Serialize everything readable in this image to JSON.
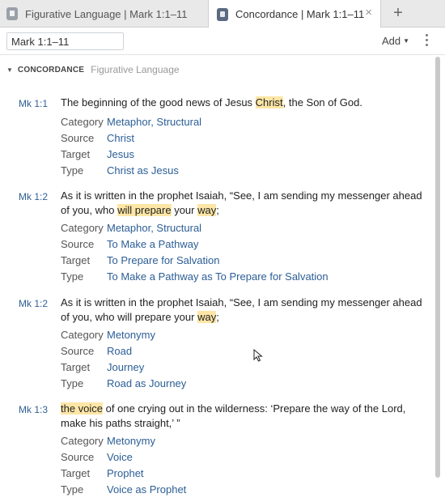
{
  "tabs": [
    {
      "label": "Figurative Language | Mark 1:1–11",
      "active": false
    },
    {
      "label": "Concordance | Mark 1:1–11",
      "active": true
    }
  ],
  "tab_close": "×",
  "tab_add": "+",
  "toolbar": {
    "reference_value": "Mark 1:1–11",
    "add_label": "Add"
  },
  "section": {
    "title": "CONCORDANCE",
    "subtitle": "Figurative Language"
  },
  "field_labels": {
    "category": "Category",
    "source": "Source",
    "target": "Target",
    "type": "Type"
  },
  "entries": [
    {
      "ref": "Mk 1:1",
      "verse": [
        {
          "t": "The beginning of the good news of Jesus "
        },
        {
          "t": "Christ",
          "hl": true
        },
        {
          "t": ", the Son of God."
        }
      ],
      "category": "Metaphor, Structural",
      "source": "Christ",
      "target": "Jesus",
      "type": "Christ as Jesus"
    },
    {
      "ref": "Mk 1:2",
      "verse": [
        {
          "t": "As it is written in the prophet Isaiah, “See, I am sending my messenger ahead of you, who "
        },
        {
          "t": "will prepare",
          "hl": true
        },
        {
          "t": " your "
        },
        {
          "t": "way",
          "hl": true
        },
        {
          "t": ";"
        }
      ],
      "category": "Metaphor, Structural",
      "source": "To Make a Pathway",
      "target": "To Prepare for Salvation",
      "type": "To Make a Pathway as To Prepare for Salvation"
    },
    {
      "ref": "Mk 1:2",
      "verse": [
        {
          "t": "As it is written in the prophet Isaiah, “See, I am sending my messenger ahead of you, who will prepare your "
        },
        {
          "t": "way",
          "hl": true
        },
        {
          "t": ";"
        }
      ],
      "category": "Metonymy",
      "source": "Road",
      "target": "Journey",
      "type": "Road as Journey"
    },
    {
      "ref": "Mk 1:3",
      "verse": [
        {
          "t": "the voice",
          "hl": true
        },
        {
          "t": " of one crying out in the wilderness: ‘Prepare the way of the Lord, make his paths straight,’ ”"
        }
      ],
      "category": "Metonymy",
      "source": "Voice",
      "target": "Prophet",
      "type": "Voice as Prophet"
    }
  ],
  "colors": {
    "highlight": "#fde6a6",
    "link": "#2c5e96",
    "tabbar": "#e9e9ea"
  }
}
